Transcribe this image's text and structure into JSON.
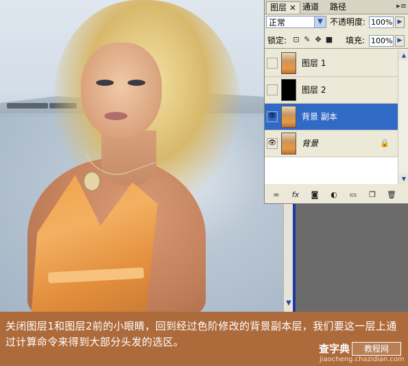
{
  "panel": {
    "tabs": [
      {
        "label": "图层 ×"
      },
      {
        "label": "通道"
      },
      {
        "label": "路径"
      }
    ],
    "blend_mode": "正常",
    "opacity_label": "不透明度:",
    "opacity_value": "100%",
    "lock_label": "锁定:",
    "fill_label": "填充:",
    "fill_value": "100%",
    "layers": [
      {
        "name": "图层 1",
        "visible": false,
        "thumb": "photo"
      },
      {
        "name": "图层 2",
        "visible": false,
        "thumb": "black"
      },
      {
        "name": "背景 副本",
        "visible": true,
        "thumb": "photo",
        "selected": true
      },
      {
        "name": "背景",
        "visible": true,
        "thumb": "photo",
        "locked": true
      }
    ],
    "bottom_icons": [
      "link-icon",
      "fx-icon",
      "mask-icon",
      "adjustment-icon",
      "folder-icon",
      "new-layer-icon",
      "trash-icon"
    ]
  },
  "caption": {
    "text": "关闭图层1和图层2前的小眼睛，回到经过色阶修改的背景副本层，我们要这一层上通过计算命令来得到大部分头发的选区。"
  },
  "watermark": {
    "brand": "查字典",
    "box": "教程网",
    "url": "jiaocheng.chazidian.com"
  },
  "colors": {
    "selection_blue": "#316ac5",
    "caption_bg": "#ad6a3b",
    "panel_bg": "#ece9d8"
  }
}
